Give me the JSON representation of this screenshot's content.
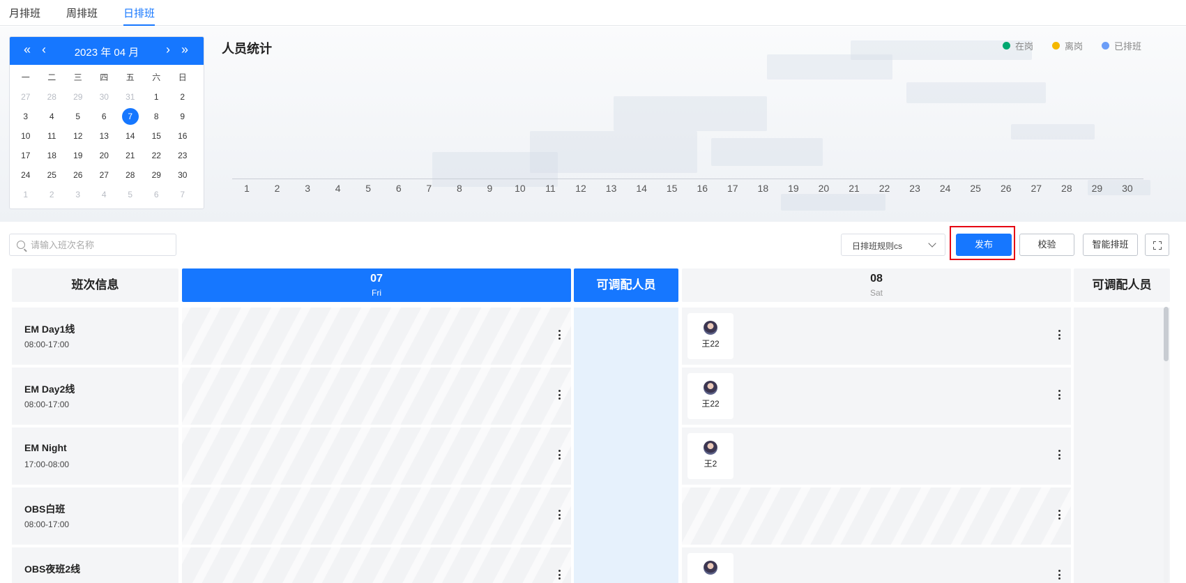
{
  "tabs": [
    "月排班",
    "周排班",
    "日排班"
  ],
  "active_tab": "日排班",
  "calendar": {
    "title": "2023 年 04 月",
    "weekdays": [
      "一",
      "二",
      "三",
      "四",
      "五",
      "六",
      "日"
    ],
    "weeks": [
      [
        "27",
        "28",
        "29",
        "30",
        "31",
        "1",
        "2"
      ],
      [
        "3",
        "4",
        "5",
        "6",
        "7",
        "8",
        "9"
      ],
      [
        "10",
        "11",
        "12",
        "13",
        "14",
        "15",
        "16"
      ],
      [
        "17",
        "18",
        "19",
        "20",
        "21",
        "22",
        "23"
      ],
      [
        "24",
        "25",
        "26",
        "27",
        "28",
        "29",
        "30"
      ],
      [
        "1",
        "2",
        "3",
        "4",
        "5",
        "6",
        "7"
      ]
    ],
    "selected": "7"
  },
  "stats": {
    "title": "人员统计",
    "legend": [
      {
        "label": "在岗",
        "color": "#00a870"
      },
      {
        "label": "离岗",
        "color": "#f5b800"
      },
      {
        "label": "已排班",
        "color": "#6c9ef8"
      }
    ],
    "x_labels": [
      "1",
      "2",
      "3",
      "4",
      "5",
      "6",
      "7",
      "8",
      "9",
      "10",
      "11",
      "12",
      "13",
      "14",
      "15",
      "16",
      "17",
      "18",
      "19",
      "20",
      "21",
      "22",
      "23",
      "24",
      "25",
      "26",
      "27",
      "28",
      "29",
      "30"
    ]
  },
  "toolbar": {
    "search_placeholder": "请输入班次名称",
    "rule_value": "日排班规则cs",
    "publish": "发布",
    "validate": "校验",
    "smart": "智能排班"
  },
  "grid": {
    "shift_header": "班次信息",
    "avail_header": "可调配人员",
    "day1": {
      "date": "07",
      "weekday": "Fri"
    },
    "day2": {
      "date": "08",
      "weekday": "Sat"
    },
    "shifts": [
      {
        "name": "EM Day1线",
        "time": "08:00-17:00",
        "day1": null,
        "day2": "王22"
      },
      {
        "name": "EM Day2线",
        "time": "08:00-17:00",
        "day1": null,
        "day2": "王22"
      },
      {
        "name": "EM Night",
        "time": "17:00-08:00",
        "day1": null,
        "day2": "王2"
      },
      {
        "name": "OBS白班",
        "time": "08:00-17:00",
        "day1": null,
        "day2": null
      },
      {
        "name": "OBS夜班2线",
        "time": "",
        "day1": null,
        "day2": ""
      }
    ]
  }
}
